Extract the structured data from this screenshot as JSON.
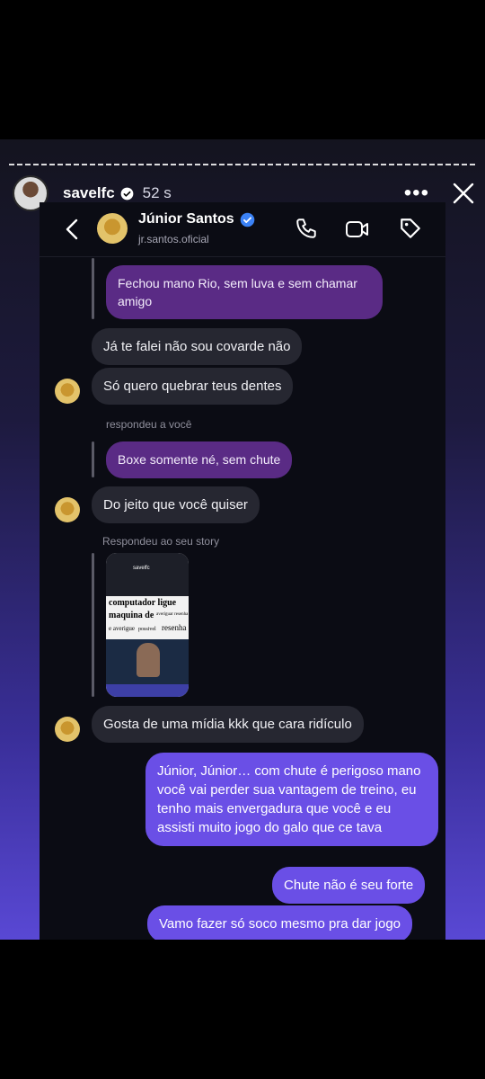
{
  "story": {
    "username": "savelfc",
    "time": "52 s",
    "more_label": "•••"
  },
  "dm": {
    "contact_name": "Júnior Santos",
    "contact_handle": "jr.santos.oficial"
  },
  "messages": {
    "m1": "Fechou mano Rio, sem luva e sem chamar amigo",
    "m2": "Já te falei não sou covarde não",
    "m3": "Só quero quebrar teus dentes",
    "meta1": "respondeu a você",
    "m4": "Boxe somente né, sem chute",
    "m5": "Do jeito que você quiser",
    "meta2": "Respondeu ao seu story",
    "m6": "Gosta de uma mídia kkk que cara ridículo",
    "m7": "Júnior, Júnior… com chute é perigoso mano você vai perder sua vantagem de treino, eu tenho mais envergadura que você e eu assisti muito jogo do galo que ce tava",
    "m8": "Chute não é seu forte",
    "m9": "Vamo fazer só soco mesmo pra dar jogo"
  },
  "story_card": {
    "username": "savelfc",
    "line1": "computador ligue",
    "line2": "maquina de",
    "line2_small": "averiguar resenha",
    "line3_a": "e averigue",
    "line3_b": "possivel",
    "line3_c": "resenha"
  },
  "colors": {
    "purple_bubble": "#5a2b85",
    "blue_bubble": "#6a4fe6",
    "gray_bubble": "#262731",
    "verified": "#3b82f6"
  }
}
